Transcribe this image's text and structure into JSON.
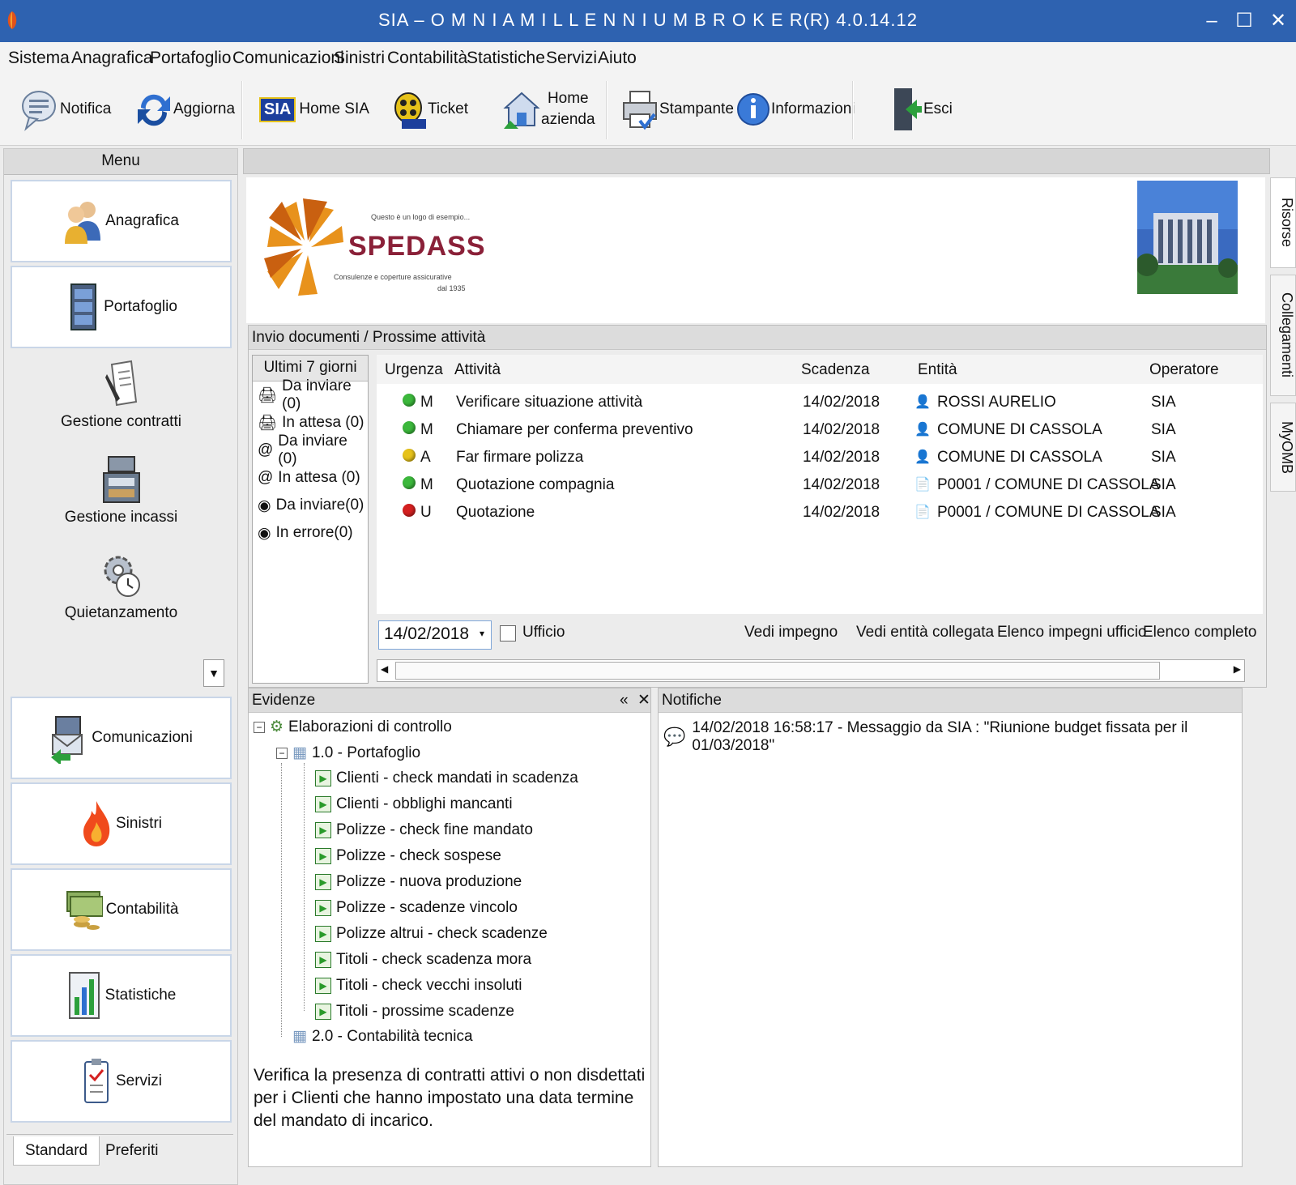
{
  "window": {
    "title": "SIA – O M N I A   M I L L E N N I U M   B R O K E R(R) 4.0.14.12",
    "minimize": "–",
    "maximize": "☐",
    "close": "✕"
  },
  "menubar": [
    "Sistema",
    "Anagrafica",
    "Portafoglio",
    "Comunicazioni",
    "Sinistri",
    "Contabilità",
    "Statistiche",
    "Servizi",
    "Aiuto"
  ],
  "toolbar": {
    "notifica": "Notifica",
    "aggiorna": "Aggiorna",
    "home_sia": "Home SIA",
    "ticket": "Ticket",
    "home_azienda_1": "Home",
    "home_azienda_2": "azienda",
    "stampante": "Stampante",
    "informazioni": "Informazioni",
    "esci": "Esci",
    "sia_badge": "SIA"
  },
  "leftmenu": {
    "header": "Menu",
    "items": [
      "Anagrafica",
      "Portafoglio",
      "Gestione contratti",
      "Gestione incassi",
      "Quietanzamento",
      "Comunicazioni",
      "Sinistri",
      "Contabilità",
      "Statistiche",
      "Servizi"
    ],
    "tabs": [
      "Standard",
      "Preferiti"
    ]
  },
  "banner": {
    "tagline": "Questo è un logo di esempio...",
    "brand": "SPEDASS",
    "subtitle_1": "Consulenze e coperture assicurative",
    "subtitle_2": "dal 1935"
  },
  "side_tabs": [
    "Risorse",
    "Collegamenti",
    "MyOMB"
  ],
  "tasks": {
    "header": "Invio documenti / Prossime attività",
    "last7_header": "Ultimi 7 giorni",
    "last7": [
      "Da inviare (0)",
      "In attesa (0)",
      "Da inviare (0)",
      "In attesa (0)",
      "Da inviare(0)",
      "In errore(0)"
    ],
    "columns": [
      "Urgenza",
      "Attività",
      "Scadenza",
      "Entità",
      "Operatore"
    ],
    "rows": [
      {
        "dot": "#3cb83c",
        "urg": "M",
        "att": "Verificare situazione attività",
        "scad": "14/02/2018",
        "ent": "ROSSI AURELIO",
        "op": "SIA"
      },
      {
        "dot": "#3cb83c",
        "urg": "M",
        "att": "Chiamare per conferma preventivo",
        "scad": "14/02/2018",
        "ent": "COMUNE DI CASSOLA",
        "op": "SIA"
      },
      {
        "dot": "#e6c21a",
        "urg": "A",
        "att": "Far firmare polizza",
        "scad": "14/02/2018",
        "ent": "COMUNE DI CASSOLA",
        "op": "SIA"
      },
      {
        "dot": "#3cb83c",
        "urg": "M",
        "att": "Quotazione compagnia",
        "scad": "14/02/2018",
        "ent": "P0001 / COMUNE DI CASSOLA",
        "op": "SIA"
      },
      {
        "dot": "#d42020",
        "urg": "U",
        "att": "Quotazione",
        "scad": "14/02/2018",
        "ent": "P0001 / COMUNE DI CASSOLA",
        "op": "SIA"
      }
    ],
    "date": "14/02/2018",
    "ufficio": "Ufficio",
    "links": [
      "Vedi impegno",
      "Vedi entità collegata",
      "Elenco impegni ufficio",
      "Elenco completo"
    ]
  },
  "evidenze": {
    "header": "Evidenze",
    "collapse": "«",
    "close": "✕",
    "root": "Elaborazioni di controllo",
    "group1": "1.0 - Portafoglio",
    "items": [
      "Clienti - check mandati in scadenza",
      "Clienti - obblighi mancanti",
      "Polizze - check fine mandato",
      "Polizze - check sospese",
      "Polizze - nuova produzione",
      "Polizze - scadenze vincolo",
      "Polizze altrui - check scadenze",
      "Titoli - check scadenza mora",
      "Titoli - check vecchi insoluti",
      "Titoli - prossime scadenze"
    ],
    "group2": "2.0 - Contabilità tecnica",
    "description": "Verifica la presenza di contratti attivi o non disdettati per i Clienti che hanno impostato una data termine del mandato di incarico."
  },
  "notifiche": {
    "header": "Notifiche",
    "message": "14/02/2018 16:58:17 - Messaggio da SIA : \"Riunione budget fissata per il 01/03/2018\""
  }
}
